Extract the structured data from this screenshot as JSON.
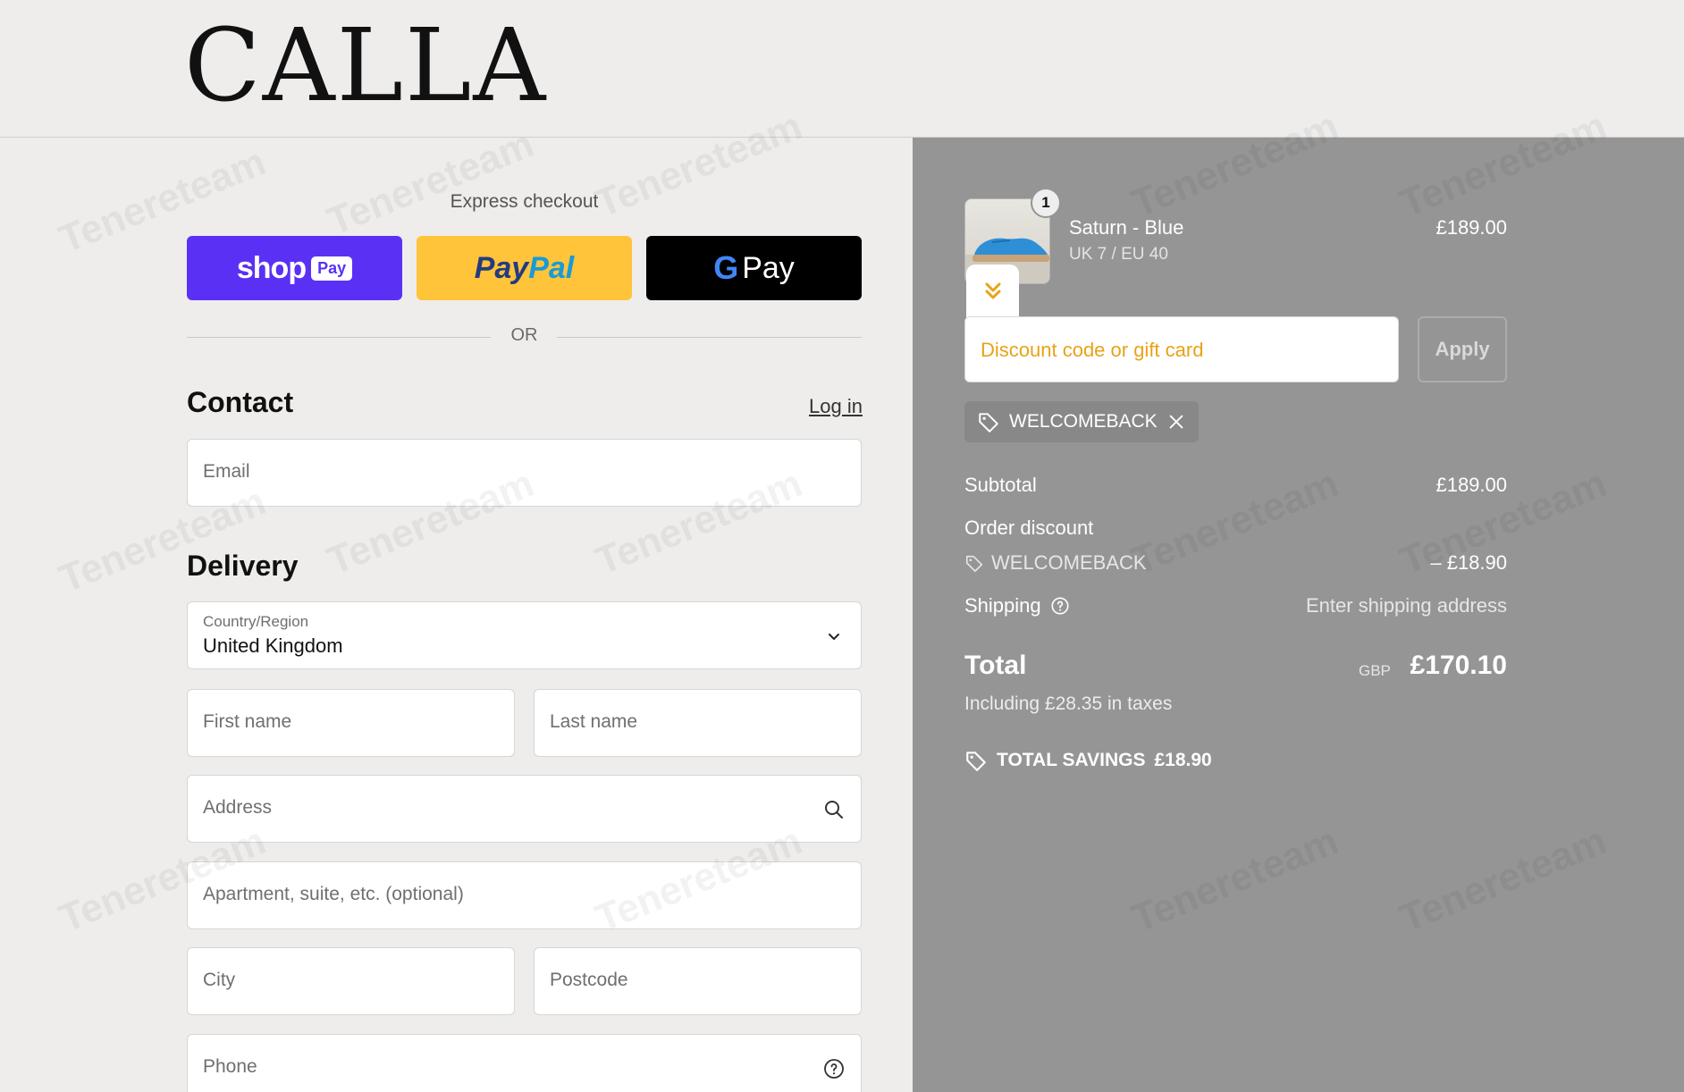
{
  "header": {
    "logo": "CALLA"
  },
  "express": {
    "label": "Express checkout",
    "shop_pay": {
      "shop": "shop",
      "pay": "Pay"
    },
    "paypal": {
      "part1": "Pay",
      "part2": "Pal"
    },
    "gpay": {
      "g": "G",
      "pay": "Pay"
    },
    "or": "OR"
  },
  "contact": {
    "title": "Contact",
    "login": "Log in",
    "email_placeholder": "Email"
  },
  "delivery": {
    "title": "Delivery",
    "country_label": "Country/Region",
    "country_value": "United Kingdom",
    "first_name": "First name",
    "last_name": "Last name",
    "address": "Address",
    "apartment": "Apartment, suite, etc. (optional)",
    "city": "City",
    "postcode": "Postcode",
    "phone": "Phone"
  },
  "summary": {
    "item": {
      "quantity": "1",
      "name": "Saturn - Blue",
      "variant": "UK 7 / EU 40",
      "price": "£189.00"
    },
    "discount_placeholder": "Discount code or gift card",
    "apply": "Apply",
    "applied_code": "WELCOMEBACK",
    "subtotal_label": "Subtotal",
    "subtotal_value": "£189.00",
    "order_discount_label": "Order discount",
    "order_discount_code": "WELCOMEBACK",
    "order_discount_value": "– £18.90",
    "shipping_label": "Shipping",
    "shipping_value": "Enter shipping address",
    "total_label": "Total",
    "total_currency": "GBP",
    "total_value": "£170.10",
    "taxes": "Including £28.35 in taxes",
    "savings_label": "TOTAL SAVINGS",
    "savings_value": "£18.90"
  },
  "watermark": "Tenereteam",
  "colors": {
    "shop_pay": "#5a31f4",
    "paypal": "#ffc439",
    "accent_orange": "#e8a316",
    "summary_bg": "#959595"
  }
}
